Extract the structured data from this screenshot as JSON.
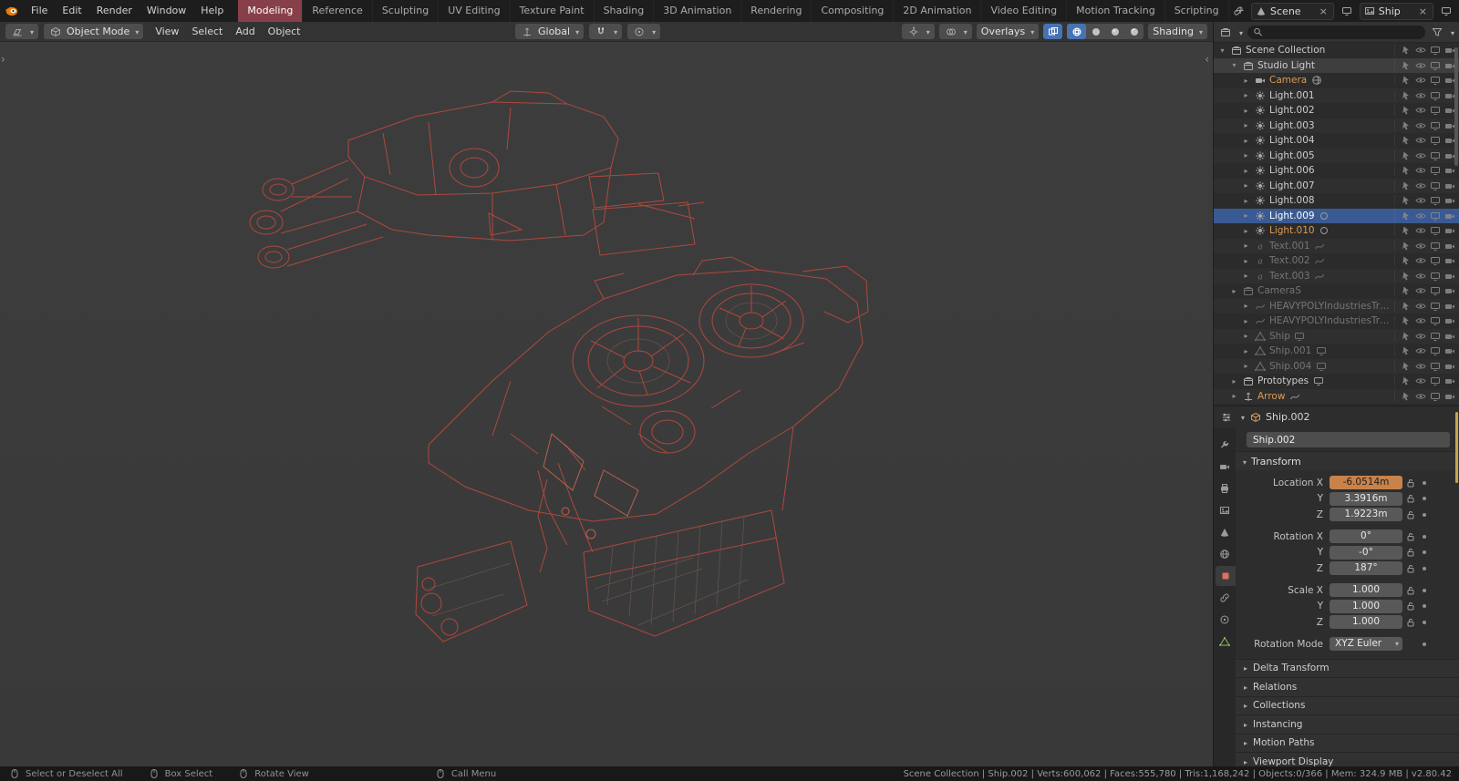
{
  "topbar": {
    "menus": [
      "File",
      "Edit",
      "Render",
      "Window",
      "Help"
    ],
    "tabs": [
      {
        "label": "Modeling",
        "active": true
      },
      {
        "label": "Reference",
        "active": false
      },
      {
        "label": "Sculpting",
        "active": false
      },
      {
        "label": "UV Editing",
        "active": false
      },
      {
        "label": "Texture Paint",
        "active": false
      },
      {
        "label": "Shading",
        "active": false
      },
      {
        "label": "3D Animation",
        "active": false
      },
      {
        "label": "Rendering",
        "active": false
      },
      {
        "label": "Compositing",
        "active": false
      },
      {
        "label": "2D Animation",
        "active": false
      },
      {
        "label": "Video Editing",
        "active": false
      },
      {
        "label": "Motion Tracking",
        "active": false
      },
      {
        "label": "Scripting",
        "active": false
      }
    ],
    "new_tab_label": "+",
    "scene_field": "Scene",
    "ship_field": "Ship"
  },
  "toolbar": {
    "mode_label": "Object Mode",
    "menus": [
      "View",
      "Select",
      "Add",
      "Object"
    ],
    "orientation_label": "Global",
    "overlays_label": "Overlays",
    "shading_label": "Shading"
  },
  "outliner": {
    "search_placeholder": "",
    "rows": [
      {
        "label": "Scene Collection",
        "icon": "collection",
        "indent": 0,
        "expander": "open",
        "tone": "normal"
      },
      {
        "label": "Studio Light",
        "icon": "collection",
        "indent": 1,
        "expander": "open",
        "tone": "normal",
        "highlight": true
      },
      {
        "label": "Camera",
        "icon": "camera",
        "indent": 2,
        "expander": "closed",
        "tone": "orange",
        "extra": "sphere"
      },
      {
        "label": "Light.001",
        "icon": "light",
        "indent": 2,
        "expander": "closed",
        "tone": "normal"
      },
      {
        "label": "Light.002",
        "icon": "light",
        "indent": 2,
        "expander": "closed",
        "tone": "normal"
      },
      {
        "label": "Light.003",
        "icon": "light",
        "indent": 2,
        "expander": "closed",
        "tone": "normal"
      },
      {
        "label": "Light.004",
        "icon": "light",
        "indent": 2,
        "expander": "closed",
        "tone": "normal"
      },
      {
        "label": "Light.005",
        "icon": "light",
        "indent": 2,
        "expander": "closed",
        "tone": "normal"
      },
      {
        "label": "Light.006",
        "icon": "light",
        "indent": 2,
        "expander": "closed",
        "tone": "normal"
      },
      {
        "label": "Light.007",
        "icon": "light",
        "indent": 2,
        "expander": "closed",
        "tone": "normal"
      },
      {
        "label": "Light.008",
        "icon": "light",
        "indent": 2,
        "expander": "closed",
        "tone": "normal"
      },
      {
        "label": "Light.009",
        "icon": "light",
        "indent": 2,
        "expander": "closed",
        "tone": "active",
        "extra": "circle"
      },
      {
        "label": "Light.010",
        "icon": "light",
        "indent": 2,
        "expander": "closed",
        "tone": "orange",
        "extra": "circle"
      },
      {
        "label": "Text.001",
        "icon": "text",
        "indent": 2,
        "expander": "closed",
        "tone": "dim",
        "extra": "curve"
      },
      {
        "label": "Text.002",
        "icon": "text",
        "indent": 2,
        "expander": "closed",
        "tone": "dim",
        "extra": "curve"
      },
      {
        "label": "Text.003",
        "icon": "text",
        "indent": 2,
        "expander": "closed",
        "tone": "dim",
        "extra": "curve"
      },
      {
        "label": "CameraS",
        "icon": "collection",
        "indent": 1,
        "expander": "closed",
        "tone": "dim"
      },
      {
        "label": "HEAVYPOLYIndustriesTra...",
        "icon": "curve",
        "indent": 2,
        "expander": "closed",
        "tone": "dim"
      },
      {
        "label": "HEAVYPOLYIndustriesTra...",
        "icon": "curve",
        "indent": 2,
        "expander": "closed",
        "tone": "dim"
      },
      {
        "label": "Ship",
        "icon": "mesh",
        "indent": 2,
        "expander": "closed",
        "tone": "dim",
        "extra": "screen"
      },
      {
        "label": "Ship.001",
        "icon": "mesh",
        "indent": 2,
        "expander": "closed",
        "tone": "dim",
        "extra": "screen"
      },
      {
        "label": "Ship.004",
        "icon": "mesh",
        "indent": 2,
        "expander": "closed",
        "tone": "dim",
        "extra": "screen"
      },
      {
        "label": "Prototypes",
        "icon": "collection",
        "indent": 1,
        "expander": "closed",
        "tone": "normal",
        "extra": "screen"
      },
      {
        "label": "Arrow",
        "icon": "empty",
        "indent": 1,
        "expander": "closed",
        "tone": "orange",
        "extra": "curve"
      }
    ]
  },
  "properties": {
    "breadcrumb": "Ship.002",
    "name_value": "Ship.002",
    "transform_title": "Transform",
    "transform_rows": [
      {
        "label": "Location X",
        "value": "-6.0514m",
        "highlight": true
      },
      {
        "label": "Y",
        "value": "3.3916m"
      },
      {
        "label": "Z",
        "value": "1.9223m"
      },
      {
        "label": "Rotation X",
        "value": "0°",
        "gap": true
      },
      {
        "label": "Y",
        "value": "-0°"
      },
      {
        "label": "Z",
        "value": "187°"
      },
      {
        "label": "Scale X",
        "value": "1.000",
        "gap": true
      },
      {
        "label": "Y",
        "value": "1.000"
      },
      {
        "label": "Z",
        "value": "1.000"
      }
    ],
    "rotation_mode_label": "Rotation Mode",
    "rotation_mode_value": "XYZ Euler",
    "collapsed_panels": [
      "Delta Transform",
      "Relations",
      "Collections",
      "Instancing",
      "Motion Paths",
      "Viewport Display"
    ],
    "tabs": [
      "tool",
      "render",
      "output",
      "viewlayer",
      "scene",
      "world",
      "object",
      "constraint",
      "physics",
      "data"
    ],
    "active_tab": "object"
  },
  "statusbar": {
    "hints": [
      "Select or Deselect All",
      "Box Select",
      "Rotate View",
      "Call Menu"
    ],
    "info": "Scene Collection | Ship.002 | Verts:600,062 | Faces:555,780 | Tris:1,168,242 | Objects:0/366 | Mem: 324.9 MB | v2.80.42"
  },
  "colors": {
    "accent_blue": "#4772b3",
    "selection_blue": "#3a5a94",
    "active_tab_red": "#87404a",
    "highlight_field_orange": "#c8824a",
    "wireframe_red": "#b5493e"
  }
}
